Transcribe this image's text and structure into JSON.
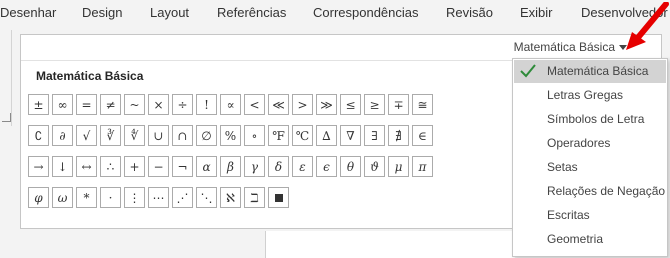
{
  "ribbon": {
    "tabs": [
      "Desenhar",
      "Design",
      "Layout",
      "Referências",
      "Correspondências",
      "Revisão",
      "Exibir",
      "Desenvolvedor"
    ]
  },
  "gallery": {
    "category_label": "Matemática Básica",
    "section_title": "Matemática Básica",
    "symbols": [
      [
        "±",
        "∞",
        "=",
        "≠",
        "~",
        "×",
        "÷",
        "!",
        "∝",
        "<",
        "≪",
        ">",
        "≫",
        "≤",
        "≥",
        "∓",
        "≅"
      ],
      [
        "∁",
        "∂",
        "√",
        "∛",
        "∜",
        "∪",
        "∩",
        "∅",
        "%",
        "∘",
        "℉",
        "℃",
        "∆",
        "∇",
        "∃",
        "∄",
        "∈"
      ],
      [
        "→",
        "↓",
        "↔",
        "∴",
        "+",
        "−",
        "¬",
        "α",
        "β",
        "γ",
        "δ",
        "ε",
        "ϵ",
        "θ",
        "ϑ",
        "μ",
        "π"
      ],
      [
        "φ",
        "ω",
        "*",
        "·",
        "⋮",
        "⋯",
        "⋰",
        "⋱",
        "ℵ",
        "ℶ",
        "■"
      ]
    ]
  },
  "menu": {
    "items": [
      {
        "label": "Matemática Básica",
        "selected": true
      },
      {
        "label": "Letras Gregas",
        "selected": false
      },
      {
        "label": "Símbolos de Letra",
        "selected": false
      },
      {
        "label": "Operadores",
        "selected": false
      },
      {
        "label": "Setas",
        "selected": false
      },
      {
        "label": "Relações de Negação",
        "selected": false
      },
      {
        "label": "Escritas",
        "selected": false
      },
      {
        "label": "Geometria",
        "selected": false
      }
    ]
  },
  "colors": {
    "check": "#2e8b3a",
    "arrow": "#e60000",
    "selected_bg": "#d3d3d3"
  }
}
